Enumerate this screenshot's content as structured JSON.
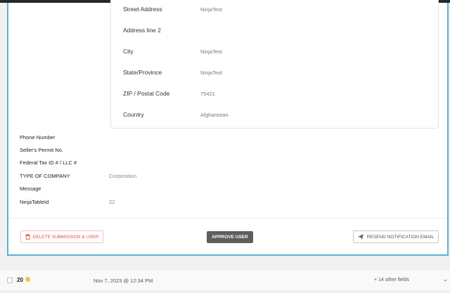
{
  "address": [
    {
      "label": "Street Address",
      "value": "NinjaTest"
    },
    {
      "label": "Address line 2",
      "value": ""
    },
    {
      "label": "City",
      "value": "NinjaTest"
    },
    {
      "label": "State/Province",
      "value": "NinjaTest"
    },
    {
      "label": "ZIP / Postal Code",
      "value": "75421"
    },
    {
      "label": "Country",
      "value": "Afghanistan"
    }
  ],
  "fields": [
    {
      "label": "Phone Number",
      "value": ""
    },
    {
      "label": "Seller's Permit No.",
      "value": ""
    },
    {
      "label": "Federal Tax ID # / LLC #",
      "value": ""
    },
    {
      "label": "TYPE OF COMPANY",
      "value": "Corporation"
    },
    {
      "label": "Message",
      "value": ""
    },
    {
      "label": "NinjaTableId",
      "value": "22"
    }
  ],
  "actions": {
    "delete_label": "DELETE SUBMISSION & USER",
    "approve_label": "APPROVE USER",
    "resend_label": "RESEND NOTIFICATION EMAIL"
  },
  "entry_row": {
    "id": "20",
    "date": "Nov 7, 2023 @ 12:34 PM",
    "other_fields": "+ 14 other fields"
  }
}
